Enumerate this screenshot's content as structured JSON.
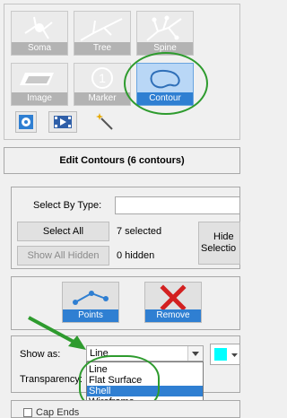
{
  "toolbar": {
    "tools": [
      {
        "name": "soma",
        "label": "Soma"
      },
      {
        "name": "tree",
        "label": "Tree"
      },
      {
        "name": "spine",
        "label": "Spine"
      },
      {
        "name": "image",
        "label": "Image"
      },
      {
        "name": "marker",
        "label": "Marker"
      },
      {
        "name": "contour",
        "label": "Contour",
        "active": true
      }
    ],
    "small_buttons": [
      "settings-icon",
      "movie-icon",
      "magic-wand-icon"
    ]
  },
  "header": {
    "title": "Edit Contours (6 contours)"
  },
  "selection": {
    "select_by_type_label": "Select By Type:",
    "select_by_type_value": "",
    "select_all_label": "Select All",
    "selected_status": "7 selected",
    "show_all_hidden_label": "Show All Hidden",
    "hidden_status": "0 hidden",
    "hide_selection_label_1": "Hide",
    "hide_selection_label_2": "Selectio"
  },
  "actions": {
    "points_label": "Points",
    "remove_label": "Remove"
  },
  "display": {
    "show_as_label": "Show as:",
    "show_as_value": "Line",
    "options": [
      "Line",
      "Flat Surface",
      "Shell",
      "Wireframe"
    ],
    "highlighted_option": "Shell",
    "transparency_label": "Transparency:",
    "color_swatch": "#00ffff"
  },
  "bottom_partial_label": "Cap Ends",
  "colors": {
    "accent": "#2f7fd2",
    "annotation_green": "#2e9b2e"
  }
}
